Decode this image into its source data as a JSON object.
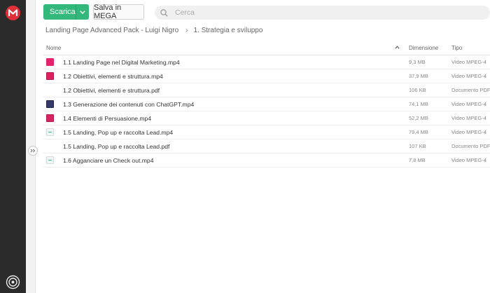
{
  "toolbar": {
    "download_label": "Scarica",
    "save_label": "Salva in MEGA"
  },
  "search": {
    "placeholder": "Cerca"
  },
  "breadcrumb": {
    "root": "Landing Page Advanced Pack - Luigi Nigro",
    "current": "1. Strategia e sviluppo"
  },
  "table": {
    "headers": {
      "name": "Nome",
      "size": "Dimensione",
      "type": "Tipo"
    },
    "rows": [
      {
        "name": "1.1 Landing Page nel Digital Marketing.mp4",
        "size": "9,3 MB",
        "type": "Video MPEG-4",
        "thumb": "pink"
      },
      {
        "name": "1.2 Obiettivi, elementi e struttura.mp4",
        "size": "37,9 MB",
        "type": "Video MPEG-4",
        "thumb": "pink2"
      },
      {
        "name": "1.2 Obiettivi, elementi e struttura.pdf",
        "size": "106 KB",
        "type": "Documento PDF",
        "thumb": "none"
      },
      {
        "name": "1.3 Generazione dei contenuti con ChatGPT.mp4",
        "size": "74,1 MB",
        "type": "Video MPEG-4",
        "thumb": "dark"
      },
      {
        "name": "1.4 Elementi di Persuasione.mp4",
        "size": "52,2 MB",
        "type": "Video MPEG-4",
        "thumb": "pink2"
      },
      {
        "name": "1.5 Landing, Pop up e raccolta Lead.mp4",
        "size": "79,4 MB",
        "type": "Video MPEG-4",
        "thumb": "light"
      },
      {
        "name": "1.5 Landing, Pop up e raccolta Lead.pdf",
        "size": "107 KB",
        "type": "Documento PDF",
        "thumb": "none"
      },
      {
        "name": "1.6 Agganciare un Check out.mp4",
        "size": "7,8 MB",
        "type": "Video MPEG-4",
        "thumb": "light"
      }
    ]
  },
  "colors": {
    "accent": "#31b87a",
    "brand": "#e0303b",
    "sidebar": "#2b2b2b"
  },
  "icons": {
    "logo": "mega-logo-icon",
    "search": "search-icon",
    "sort": "sort-up-icon",
    "expand": "expand-sidebar-icon",
    "transfers": "transfers-icon"
  }
}
